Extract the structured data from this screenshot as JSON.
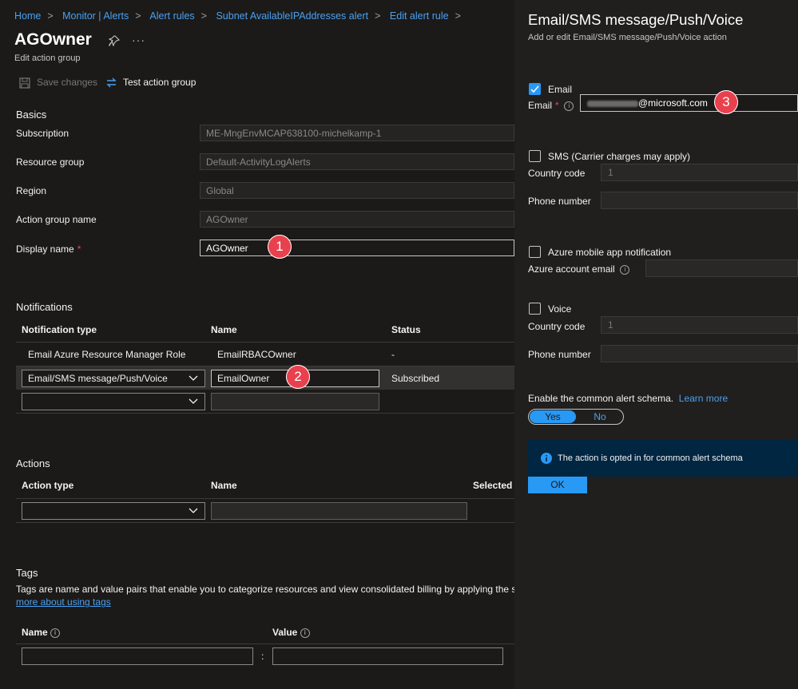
{
  "breadcrumb": [
    "Home",
    "Monitor | Alerts",
    "Alert rules",
    "Subnet AvailableIPAddresses alert",
    "Edit alert rule"
  ],
  "page": {
    "title": "AGOwner",
    "subtitle": "Edit action group"
  },
  "toolbar": {
    "save_label": "Save changes",
    "test_label": "Test action group"
  },
  "basics": {
    "heading": "Basics",
    "subscription_label": "Subscription",
    "subscription_value": "ME-MngEnvMCAP638100-michelkamp-1",
    "resource_group_label": "Resource group",
    "resource_group_value": "Default-ActivityLogAlerts",
    "region_label": "Region",
    "region_value": "Global",
    "action_group_name_label": "Action group name",
    "action_group_name_value": "AGOwner",
    "display_name_label": "Display name",
    "display_name_value": "AGOwner"
  },
  "callouts": [
    "1",
    "2",
    "3"
  ],
  "notifications": {
    "heading": "Notifications",
    "columns": [
      "Notification type",
      "Name",
      "Status"
    ],
    "rows": [
      {
        "type": "Email Azure Resource Manager Role",
        "name": "EmailRBACOwner",
        "status": "-"
      },
      {
        "type": "Email/SMS message/Push/Voice",
        "name": "EmailOwner",
        "status": "Subscribed"
      }
    ]
  },
  "actions": {
    "heading": "Actions",
    "columns": [
      "Action type",
      "Name",
      "Selected"
    ]
  },
  "tags": {
    "heading": "Tags",
    "description": "Tags are name and value pairs that enable you to categorize resources and view consolidated billing by applying the sa",
    "link": "more about using tags",
    "name_label": "Name",
    "value_label": "Value",
    "separator": ":"
  },
  "panel": {
    "title": "Email/SMS message/Push/Voice",
    "subtitle": "Add or edit Email/SMS message/Push/Voice action",
    "email_check_label": "Email",
    "email_label": "Email",
    "email_value": "@microsoft.com",
    "sms_check_label": "SMS (Carrier charges may apply)",
    "country_code_label": "Country code",
    "country_code_value": "1",
    "phone_label": "Phone number",
    "push_check_label": "Azure mobile app notification",
    "azure_email_label": "Azure account email",
    "voice_check_label": "Voice",
    "voice_country_label": "Country code",
    "voice_country_value": "1",
    "voice_phone_label": "Phone number",
    "schema_label": "Enable the common alert schema.",
    "learn_more": "Learn more",
    "toggle_yes": "Yes",
    "toggle_no": "No",
    "info_text": "The action is opted in for common alert schema",
    "ok_label": "OK"
  },
  "colors": {
    "accent": "#2899f5",
    "link": "#4aa0f0",
    "badge": "#e8414d",
    "info_bg": "#002642"
  }
}
